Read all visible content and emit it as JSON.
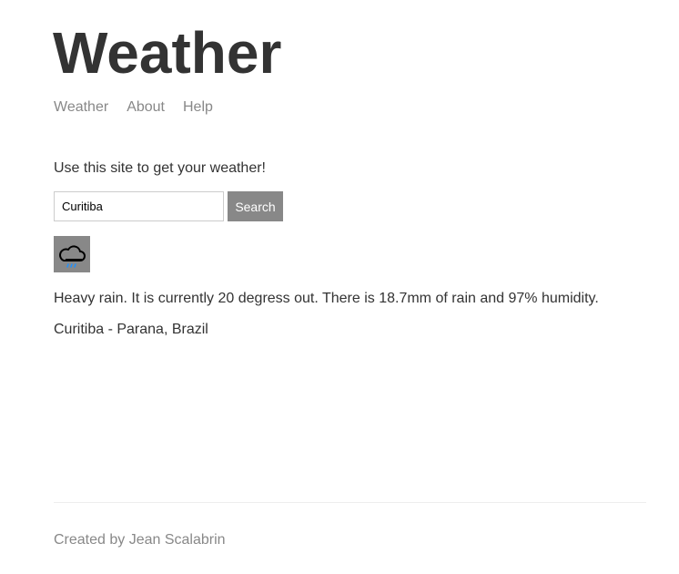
{
  "header": {
    "title": "Weather"
  },
  "nav": {
    "items": [
      {
        "label": "Weather"
      },
      {
        "label": "About"
      },
      {
        "label": "Help"
      }
    ]
  },
  "main": {
    "intro": "Use this site to get your weather!",
    "search": {
      "value": "Curitiba",
      "button_label": "Search"
    },
    "weather_icon": "heavy-rain-cloud-icon",
    "description": "Heavy rain. It is currently 20 degress out. There is 18.7mm of rain and 97% humidity.",
    "location": "Curitiba - Parana, Brazil"
  },
  "footer": {
    "text": "Created by Jean Scalabrin"
  },
  "colors": {
    "text": "#333333",
    "muted": "#888888",
    "button_bg": "#888888",
    "icon_bg": "#888888",
    "rain_drops": "#1e90ff"
  }
}
